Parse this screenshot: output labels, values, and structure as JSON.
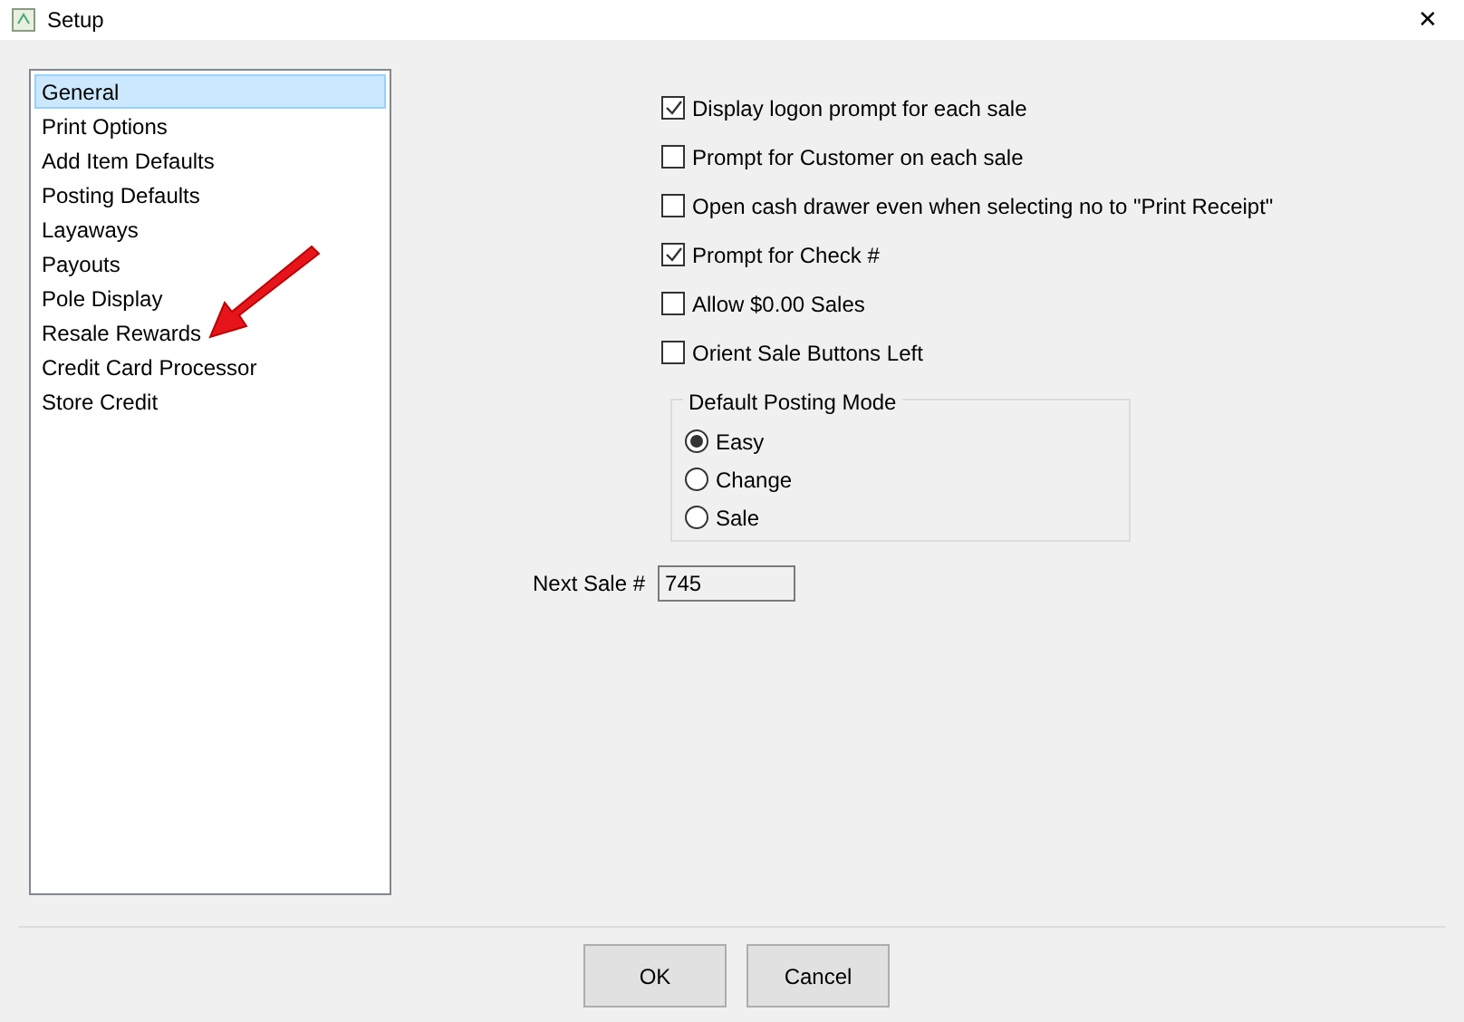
{
  "window": {
    "title": "Setup",
    "close": "✕"
  },
  "sidebar": {
    "items": [
      {
        "label": "General",
        "selected": true
      },
      {
        "label": "Print Options",
        "selected": false
      },
      {
        "label": "Add Item Defaults",
        "selected": false
      },
      {
        "label": "Posting Defaults",
        "selected": false
      },
      {
        "label": "Layaways",
        "selected": false
      },
      {
        "label": "Payouts",
        "selected": false
      },
      {
        "label": "Pole Display",
        "selected": false
      },
      {
        "label": "Resale Rewards",
        "selected": false
      },
      {
        "label": "Credit Card Processor",
        "selected": false
      },
      {
        "label": "Store Credit",
        "selected": false
      }
    ]
  },
  "options": [
    {
      "label": "Display logon prompt for each sale",
      "checked": true
    },
    {
      "label": "Prompt for Customer on each sale",
      "checked": false
    },
    {
      "label": "Open cash drawer even when selecting no to \"Print Receipt\"",
      "checked": false
    },
    {
      "label": "Prompt for Check #",
      "checked": true
    },
    {
      "label": "Allow $0.00 Sales",
      "checked": false
    },
    {
      "label": "Orient Sale Buttons Left",
      "checked": false
    }
  ],
  "posting_mode": {
    "title": "Default Posting Mode",
    "choices": [
      {
        "label": "Easy",
        "selected": true
      },
      {
        "label": "Change",
        "selected": false
      },
      {
        "label": "Sale",
        "selected": false
      }
    ]
  },
  "next_sale": {
    "label": "Next Sale #",
    "value": "745"
  },
  "buttons": [
    "OK",
    "Cancel"
  ]
}
